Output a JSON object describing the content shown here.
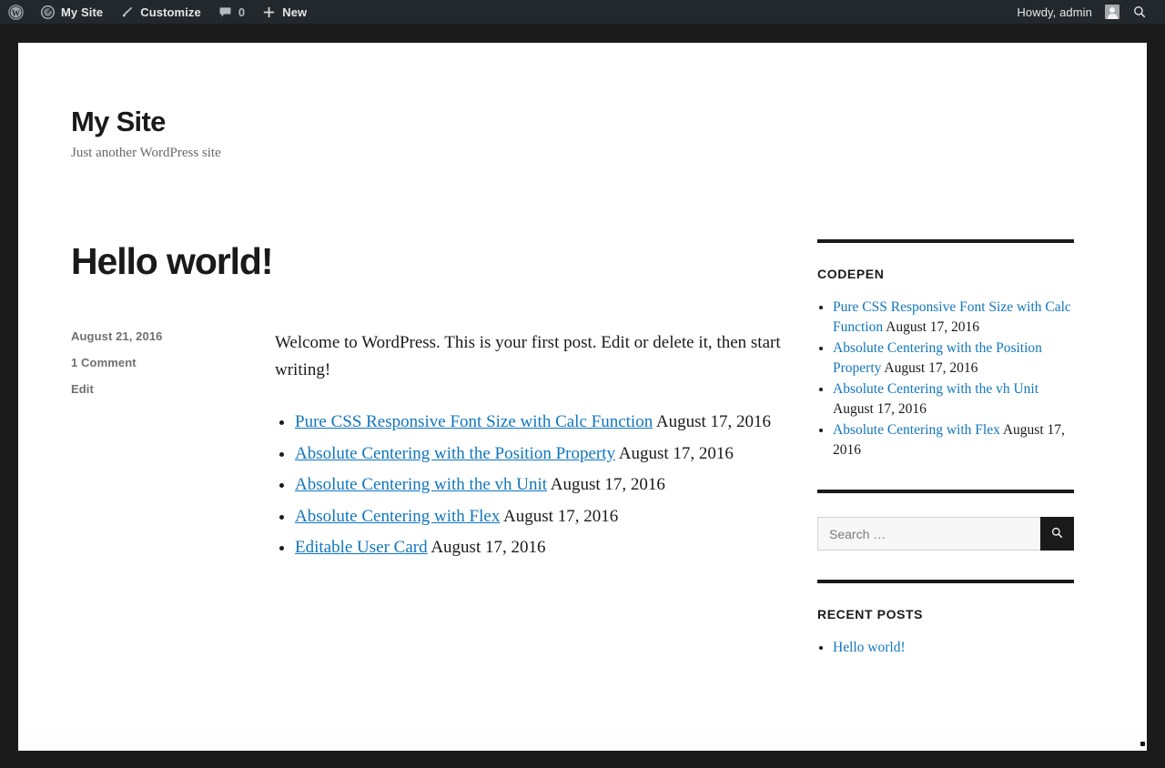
{
  "adminbar": {
    "wp_logo_label": "W",
    "site_name": "My Site",
    "customize_label": "Customize",
    "comments_count": "0",
    "new_label": "New",
    "howdy": "Howdy, admin"
  },
  "branding": {
    "title": "My Site",
    "tagline": "Just another WordPress site"
  },
  "post": {
    "title": "Hello world!",
    "date": "August 21, 2016",
    "comments": "1 Comment",
    "edit": "Edit",
    "paragraph": "Welcome to WordPress. This is your first post. Edit or delete it, then start writing!",
    "links": [
      {
        "text": "Pure CSS Responsive Font Size with Calc Function",
        "date": "August 17, 2016"
      },
      {
        "text": "Absolute Centering with the Position Property",
        "date": "August 17, 2016"
      },
      {
        "text": "Absolute Centering with the vh Unit",
        "date": "August 17, 2016"
      },
      {
        "text": "Absolute Centering with Flex",
        "date": "August 17, 2016"
      },
      {
        "text": "Editable User Card",
        "date": "August 17, 2016"
      }
    ]
  },
  "sidebar": {
    "codepen": {
      "title": "CODEPEN",
      "items": [
        {
          "text": "Pure CSS Responsive Font Size with Calc Function",
          "date": "August 17, 2016"
        },
        {
          "text": "Absolute Centering with the Position Property",
          "date": "August 17, 2016"
        },
        {
          "text": "Absolute Centering with the vh Unit",
          "date": "August 17, 2016"
        },
        {
          "text": "Absolute Centering with Flex",
          "date": "August 17, 2016"
        }
      ]
    },
    "search": {
      "placeholder": "Search …",
      "value": ""
    },
    "recent_posts": {
      "title": "RECENT POSTS",
      "items": [
        {
          "text": "Hello world!"
        }
      ]
    }
  },
  "colors": {
    "link": "#1176bd",
    "adminbar_bg": "#23282d",
    "page_bg": "#1b1b1b",
    "text": "#1a1a1a",
    "meta": "#707070"
  }
}
